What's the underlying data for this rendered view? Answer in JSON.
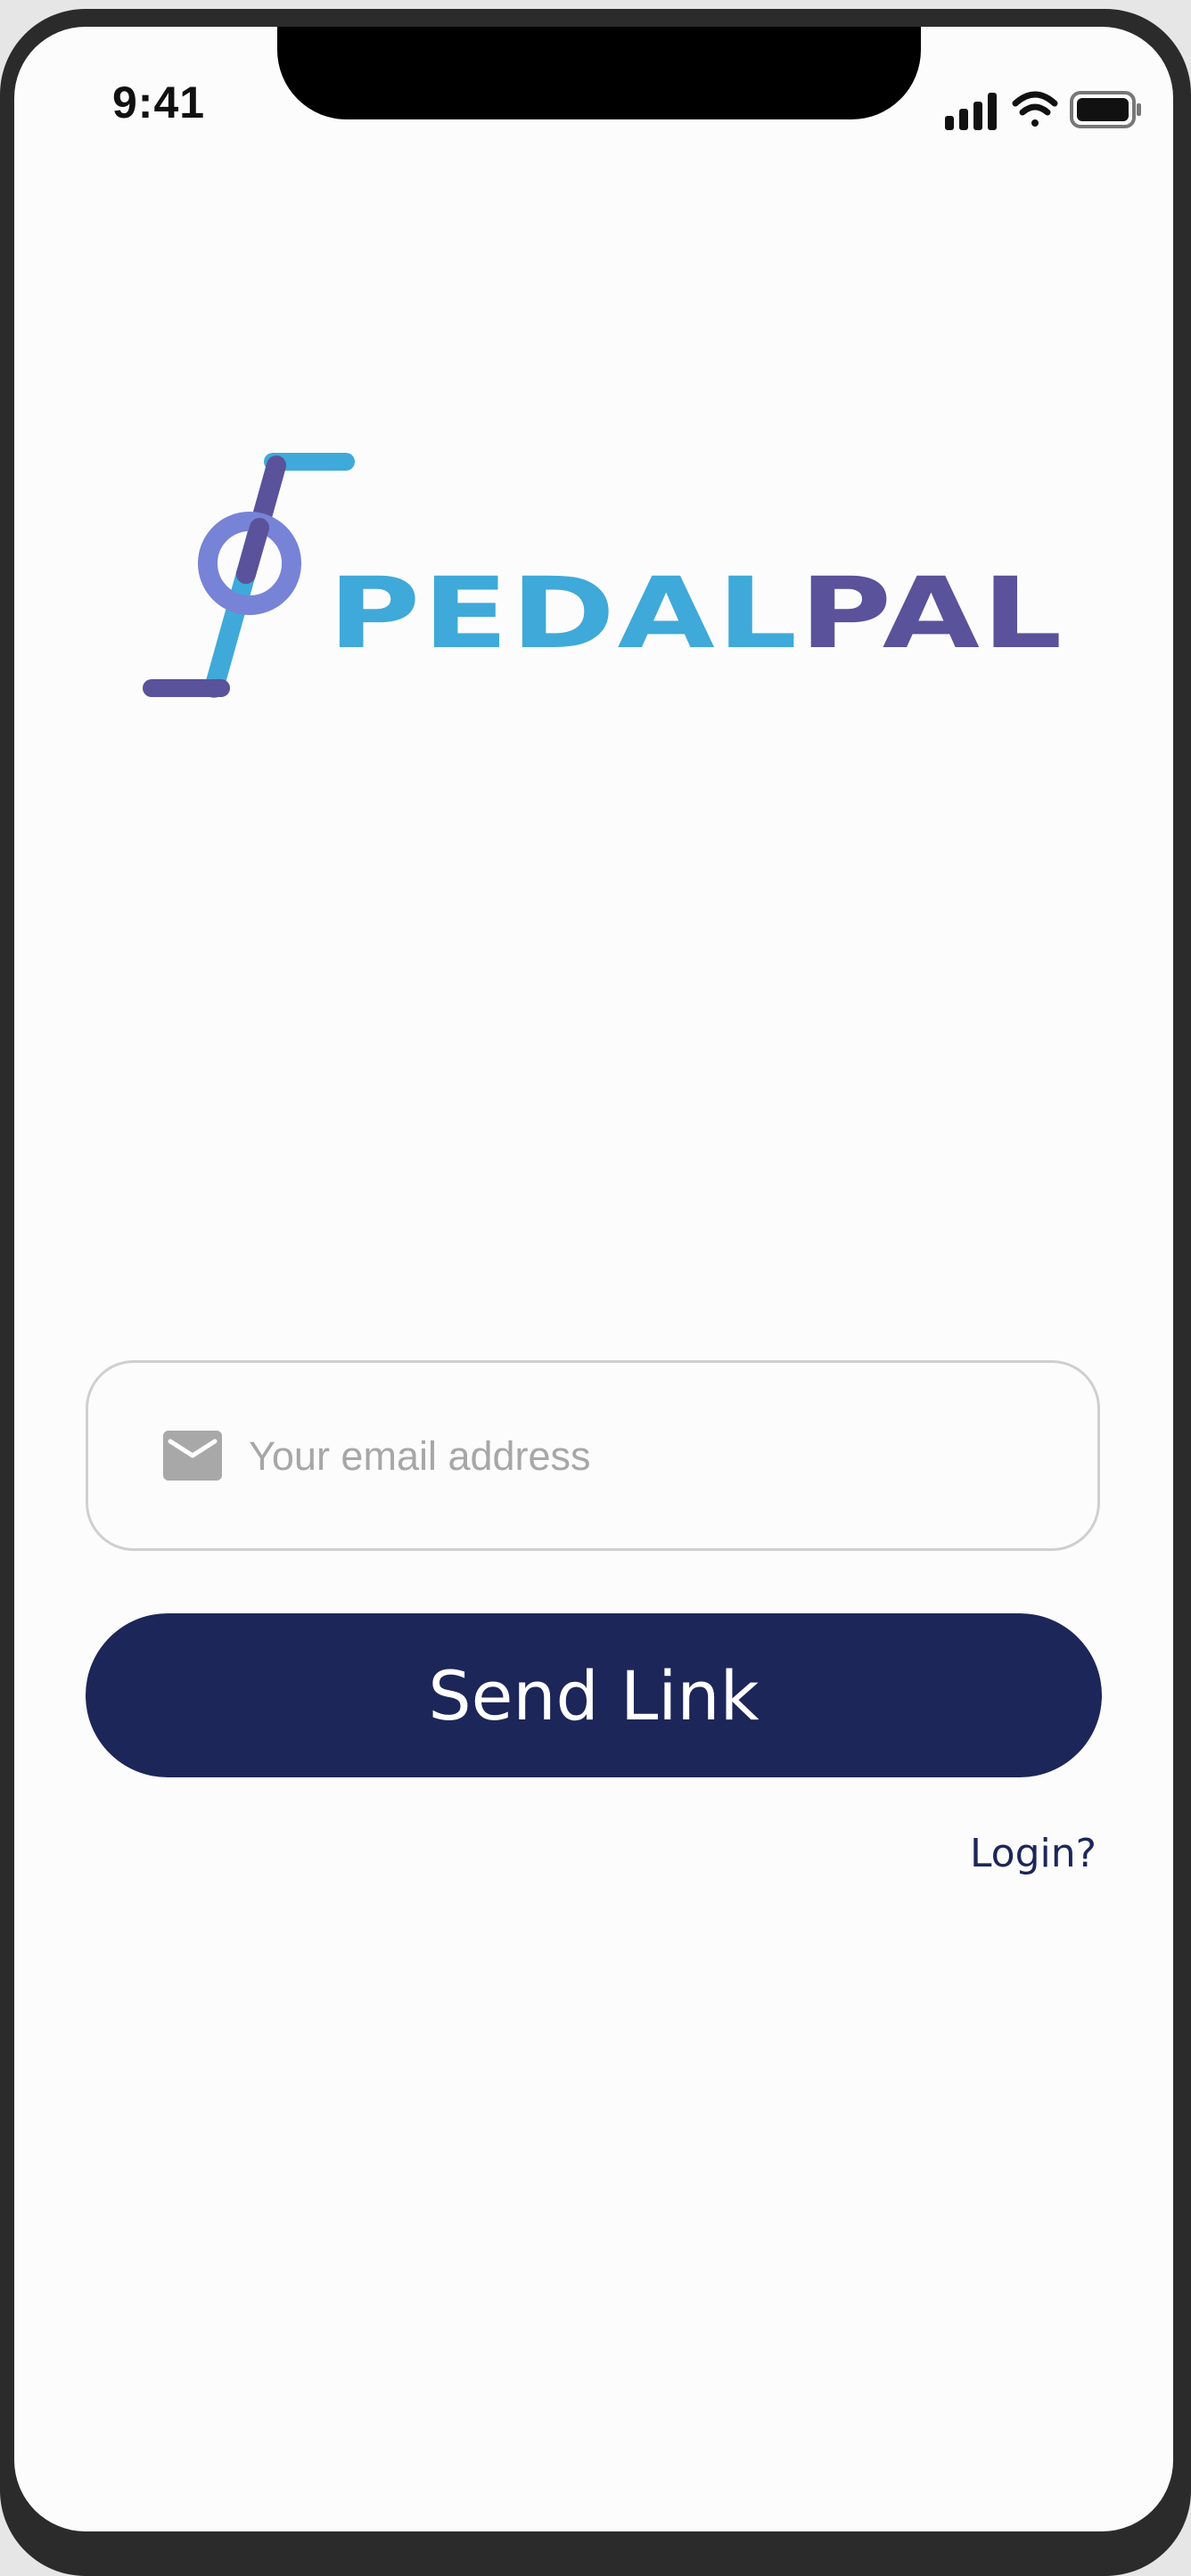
{
  "status_bar": {
    "time": "9:41",
    "icons": [
      "cellular-signal-icon",
      "wifi-icon",
      "battery-icon"
    ]
  },
  "brand": {
    "name_part1": "PEDAL",
    "name_part2": "PAL",
    "colors": {
      "primary_blue": "#3fa9d9",
      "primary_purple": "#5a529a",
      "ring": "#7783d6"
    }
  },
  "form": {
    "email_placeholder": "Your email address",
    "email_value": "",
    "email_icon": "mail-icon"
  },
  "actions": {
    "send_label": "Send Link",
    "login_label": "Login?"
  },
  "colors": {
    "button_bg": "#1c2659",
    "button_text": "#ffffff",
    "field_border": "#cfcfcf",
    "placeholder": "#a7a7a7",
    "background": "#fcfcfc"
  }
}
